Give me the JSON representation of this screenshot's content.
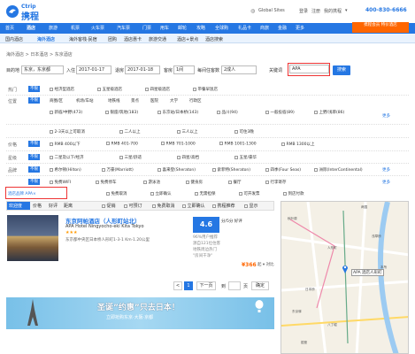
{
  "header": {
    "logo_top": "Ctrip",
    "logo_main": "携程",
    "global_sites": "Global Sites",
    "links": [
      "登录",
      "注册",
      "我的携程",
      "▾"
    ],
    "phone": "400-830-6666"
  },
  "nav": {
    "items": [
      "首页",
      "酒店",
      "旅游",
      "机票",
      "火车票",
      "汽车票",
      "门票",
      "用车",
      "邮轮",
      "攻略",
      "全球购",
      "礼品卡",
      "商旅",
      "金融",
      "更多"
    ],
    "promo": "携程会员 特价酒店"
  },
  "subnav": {
    "items": [
      "国内酒店",
      "海外酒店",
      "海外客栈·民宿",
      "团购",
      "酒店惠卡",
      "旅游交通",
      "酒店+景点",
      "酒店搜索"
    ]
  },
  "breadcrumb": "海外酒店 > 日本酒店 > 东京酒店",
  "search": {
    "dest_label": "目的地",
    "dest_value": "东京，东京都",
    "checkin_label": "入住",
    "checkin_value": "2017-01-17",
    "checkout_label": "退房",
    "checkout_value": "2017-01-18",
    "room_label": "客房",
    "room_value": "1间",
    "guest_label": "每间住客数",
    "guest_value": "2成人",
    "keyword_label": "关键词",
    "keyword_value": "APA",
    "search_btn": "搜索"
  },
  "filters": {
    "unlimited": "不限",
    "more": "更多",
    "rows": [
      {
        "label": "热门",
        "options": [
          "经济型酒店",
          "五星级酒店",
          "四星级酒店",
          "带餐早饭店"
        ]
      },
      {
        "label": "位置",
        "options": [
          "商圈/区",
          "机场/车站",
          "地铁线",
          "景点",
          "医院",
          "大学",
          "行政区"
        ]
      },
      {
        "label": "",
        "options": [
          "新宿/中野(473)",
          "银座/筑地(183)",
          "东京站/日本桥(143)",
          "品川(94)",
          "一般投宿(89)",
          "上野/浅草(86)"
        ]
      },
      {
        "label": "",
        "options": [
          "2-3天以上可取消",
          "二人以上",
          "三人以上",
          "可住3晚"
        ]
      },
      {
        "label": "价格",
        "options": [
          "RMB 400以下",
          "RMB 401-700",
          "RMB 701-1000",
          "RMB 1001-1300",
          "RMB 1300以上"
        ]
      },
      {
        "label": "星级",
        "options": [
          "二星及以下/经济",
          "三星/舒适",
          "四星/高档",
          "五星/豪华"
        ]
      },
      {
        "label": "品牌",
        "options": [
          "希尔顿(Hilton)",
          "万豪(Marriott)",
          "喜来登(Sheraton)",
          "索菲特(Sheraton)",
          "四季(Four Seas)",
          "洲际(InterContinental)"
        ]
      },
      {
        "label": "",
        "options": [
          "免费WIFI",
          "免费停车",
          "游泳池",
          "健身房",
          "餐厅",
          "行李寄存"
        ]
      },
      {
        "label": "",
        "options": [
          "免费取消",
          "立即确认",
          "无需担保",
          "可开发票",
          "到店付款"
        ]
      }
    ],
    "selected_tag": "酒店品牌 APA×"
  },
  "sort": {
    "tabs": [
      "欢迎度",
      "价格",
      "好评",
      "距离"
    ],
    "checks": [
      "促销",
      "可预订",
      "免费取消",
      "立即确认",
      "携程推荐",
      "显示"
    ]
  },
  "hotel": {
    "name": "东京阿帕酒店（人形町站北）",
    "en_name": "APA Hotel Ningyocho-eki Kita Tokyo",
    "stars": "★★★",
    "address": "东京都中央区日本桥人形町1-3-1 Km·1.20公里",
    "score": "4.6",
    "score_label": "分/5分 好评",
    "reviews": [
      "96%用户推荐",
      "源自121位住客",
      "地铁周边热门",
      "\"房间干净\""
    ],
    "price": "¥366",
    "compare": "起 ▾ 对比"
  },
  "pagination": {
    "prev": "<",
    "current": "1",
    "next_label": "下一页",
    "to": "到",
    "page": "页",
    "go": "确定"
  },
  "banner": {
    "title": "圣诞”约惠”只去日本！",
    "subtitle": "立即抢购东京·大阪·京都"
  },
  "map": {
    "marker_label": "APA 酒店人形町",
    "labels": [
      "本所",
      "日本桥",
      "东京驿",
      "银座",
      "八丁堀",
      "人形町",
      "浅草桥",
      "两国",
      "秋叶原"
    ]
  }
}
